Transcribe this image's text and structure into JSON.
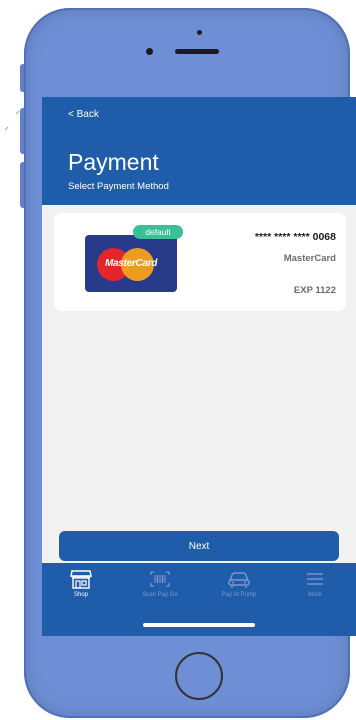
{
  "header": {
    "back_label": "< Back",
    "title": "Payment",
    "subtitle": "Select Payment Method"
  },
  "card": {
    "badge": "default",
    "number": "**** **** **** 0068",
    "brand": "MasterCard",
    "expiry": "EXP 1122",
    "logo_text": "MasterCard"
  },
  "actions": {
    "next_label": "Next"
  },
  "tabbar": {
    "items": [
      {
        "label": "Shop",
        "icon": "store-icon",
        "active": true
      },
      {
        "label": "Scan Pay Go",
        "icon": "barcode-icon",
        "active": false
      },
      {
        "label": "Pay At Pump",
        "icon": "car-icon",
        "active": false
      },
      {
        "label": "More",
        "icon": "menu-icon",
        "active": false
      }
    ]
  },
  "colors": {
    "brand_blue": "#1f5dab",
    "phone_frame": "#6e8fd6",
    "badge_green": "#3bbf95",
    "screen_bg": "#f2f2f2"
  }
}
